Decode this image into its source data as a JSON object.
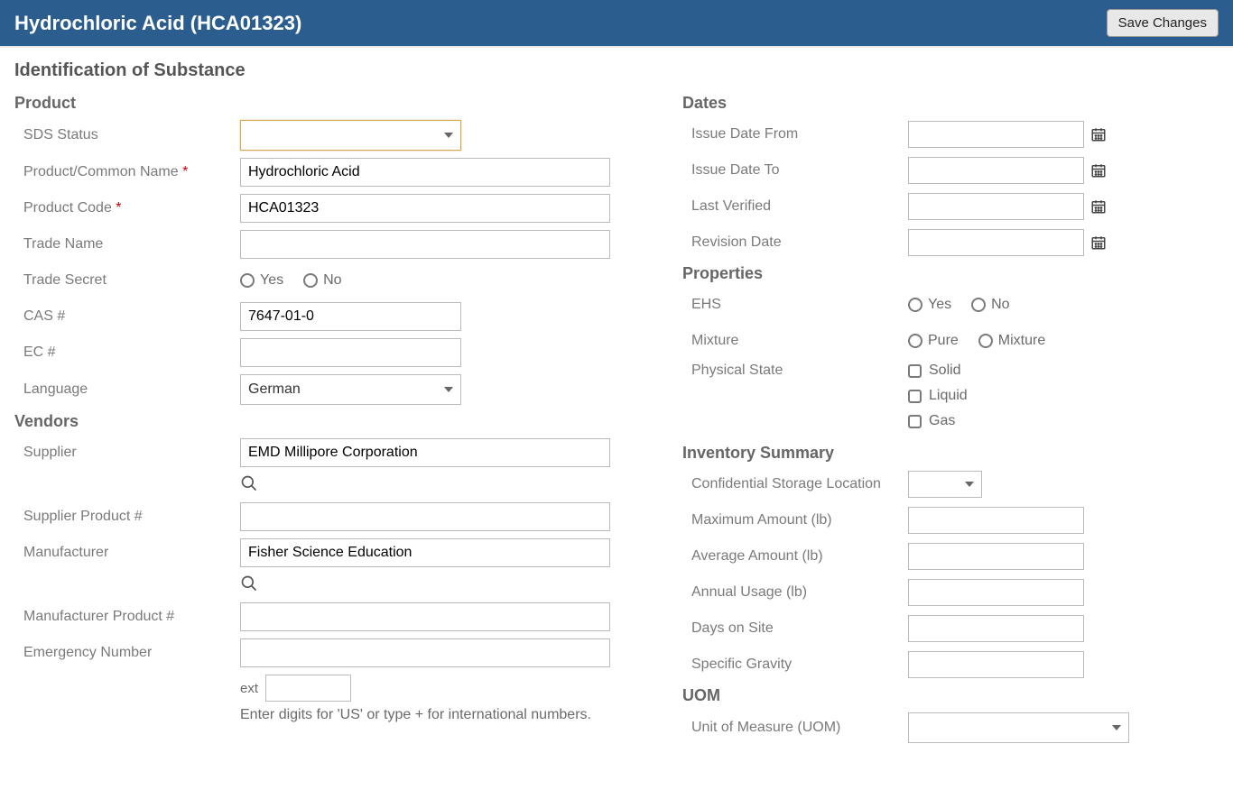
{
  "header": {
    "title": "Hydrochloric Acid (HCA01323)",
    "save_label": "Save Changes"
  },
  "section_title": "Identification of Substance",
  "product": {
    "heading": "Product",
    "sds_status_label": "SDS Status",
    "sds_status_value": "",
    "name_label": "Product/Common Name",
    "name_value": "Hydrochloric Acid",
    "code_label": "Product Code",
    "code_value": "HCA01323",
    "trade_name_label": "Trade Name",
    "trade_name_value": "",
    "trade_secret_label": "Trade Secret",
    "trade_secret_yes": "Yes",
    "trade_secret_no": "No",
    "cas_label": "CAS #",
    "cas_value": "7647-01-0",
    "ec_label": "EC #",
    "ec_value": "",
    "language_label": "Language",
    "language_value": "German"
  },
  "vendors": {
    "heading": "Vendors",
    "supplier_label": "Supplier",
    "supplier_value": "EMD Millipore Corporation",
    "supplier_product_label": "Supplier Product #",
    "supplier_product_value": "",
    "manufacturer_label": "Manufacturer",
    "manufacturer_value": "Fisher Science Education",
    "manufacturer_product_label": "Manufacturer Product #",
    "manufacturer_product_value": "",
    "emergency_label": "Emergency Number",
    "emergency_value": "",
    "ext_label": "ext",
    "ext_value": "",
    "emergency_hint": "Enter digits for 'US' or type + for international numbers."
  },
  "dates": {
    "heading": "Dates",
    "issue_from_label": "Issue Date From",
    "issue_to_label": "Issue Date To",
    "last_verified_label": "Last Verified",
    "revision_label": "Revision Date"
  },
  "properties": {
    "heading": "Properties",
    "ehs_label": "EHS",
    "ehs_yes": "Yes",
    "ehs_no": "No",
    "mixture_label": "Mixture",
    "mixture_pure": "Pure",
    "mixture_mixture": "Mixture",
    "physical_state_label": "Physical State",
    "ps_solid": "Solid",
    "ps_liquid": "Liquid",
    "ps_gas": "Gas"
  },
  "inventory": {
    "heading": "Inventory Summary",
    "conf_loc_label": "Confidential Storage Location",
    "max_label": "Maximum Amount (lb)",
    "avg_label": "Average Amount (lb)",
    "annual_label": "Annual Usage (lb)",
    "days_label": "Days on Site",
    "gravity_label": "Specific Gravity"
  },
  "uom": {
    "heading": "UOM",
    "uom_label": "Unit of Measure (UOM)"
  }
}
